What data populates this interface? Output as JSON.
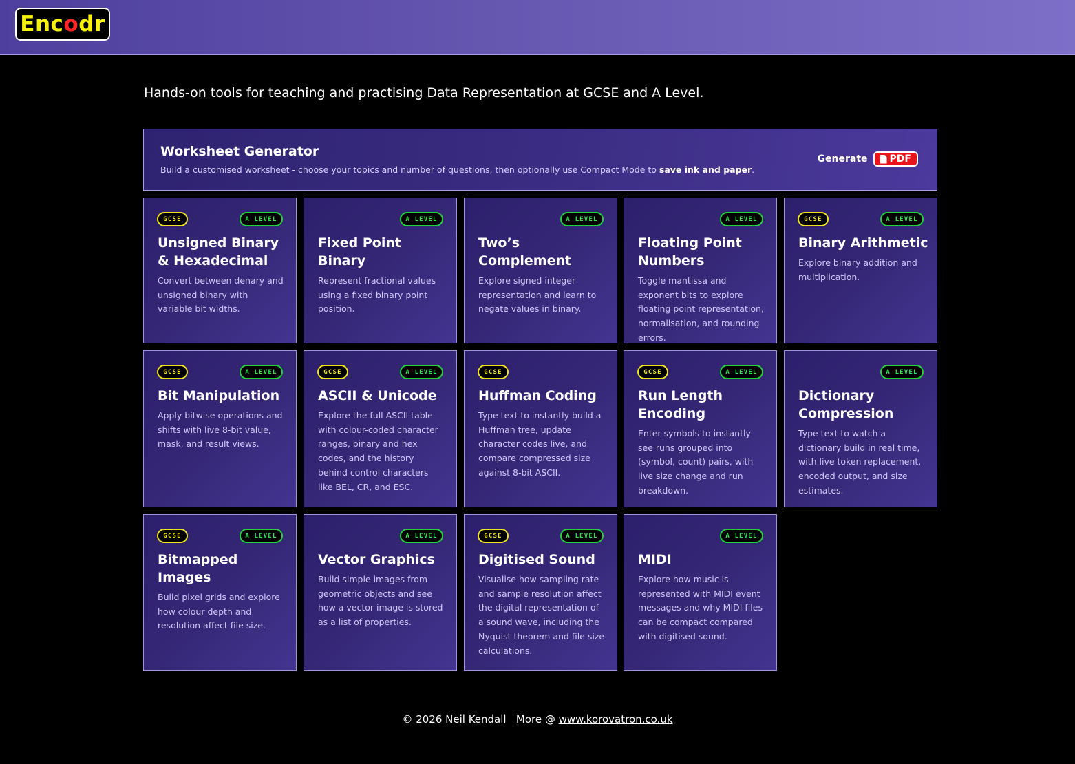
{
  "header": {
    "logo": {
      "part1": "Enc",
      "part2": "o",
      "part3": "dr"
    }
  },
  "tagline": "Hands-on tools for teaching and practising Data Representation at GCSE and A Level.",
  "worksheet": {
    "title": "Worksheet Generator",
    "desc_pre": "Build a customised worksheet - choose your topics and number of questions, then optionally use Compact Mode to ",
    "desc_bold": "save ink and paper",
    "desc_post": ".",
    "generate_label": "Generate",
    "pdf_label": "PDF"
  },
  "cards": [
    {
      "title": "Unsigned Binary & Hexadecimal",
      "desc": "Convert between denary and unsigned binary with variable bit widths.",
      "gcse": "GCSE",
      "alevel": "A LEVEL"
    },
    {
      "title": "Fixed Point Binary",
      "desc": "Represent fractional values using a fixed binary point position.",
      "alevel": "A LEVEL"
    },
    {
      "title": "Two’s Complement",
      "desc": "Explore signed integer representation and learn to negate values in binary.",
      "alevel": "A LEVEL"
    },
    {
      "title": "Floating Point Numbers",
      "desc": "Toggle mantissa and exponent bits to explore floating point representation, normalisation, and rounding errors.",
      "alevel": "A LEVEL"
    },
    {
      "title": "Binary Arithmetic",
      "desc": "Explore binary addition and multiplication.",
      "gcse": "GCSE",
      "alevel": "A LEVEL"
    },
    {
      "title": "Bit Manipulation",
      "desc": "Apply bitwise operations and shifts with live 8-bit value, mask, and result views.",
      "gcse": "GCSE",
      "alevel": "A LEVEL"
    },
    {
      "title": "ASCII & Unicode",
      "desc": "Explore the full ASCII table with colour-coded character ranges, binary and hex codes, and the history behind control characters like BEL, CR, and ESC.",
      "gcse": "GCSE",
      "alevel": "A LEVEL"
    },
    {
      "title": "Huffman Coding",
      "desc": "Type text to instantly build a Huffman tree, update character codes live, and compare compressed size against 8-bit ASCII.",
      "gcse": "GCSE"
    },
    {
      "title": "Run Length Encoding",
      "desc": "Enter symbols to instantly see runs grouped into (symbol, count) pairs, with live size change and run breakdown.",
      "gcse": "GCSE",
      "alevel": "A LEVEL"
    },
    {
      "title": "Dictionary Compression",
      "desc": "Type text to watch a dictionary build in real time, with live token replacement, encoded output, and size estimates.",
      "alevel": "A LEVEL"
    },
    {
      "title": "Bitmapped Images",
      "desc": "Build pixel grids and explore how colour depth and resolution affect file size.",
      "gcse": "GCSE",
      "alevel": "A LEVEL"
    },
    {
      "title": "Vector Graphics",
      "desc": "Build simple images from geometric objects and see how a vector image is stored as a list of properties.",
      "alevel": "A LEVEL"
    },
    {
      "title": "Digitised Sound",
      "desc": "Visualise how sampling rate and sample resolution affect the digital representation of a sound wave, including the Nyquist theorem and file size calculations.",
      "gcse": "GCSE",
      "alevel": "A LEVEL"
    },
    {
      "title": "MIDI",
      "desc": "Explore how music is represented with MIDI event messages and why MIDI files can be compact compared with digitised sound.",
      "alevel": "A LEVEL"
    }
  ],
  "footer": {
    "copyright": "© 2026 Neil Kendall",
    "more": "More @",
    "link": "www.korovatron.co.uk"
  }
}
